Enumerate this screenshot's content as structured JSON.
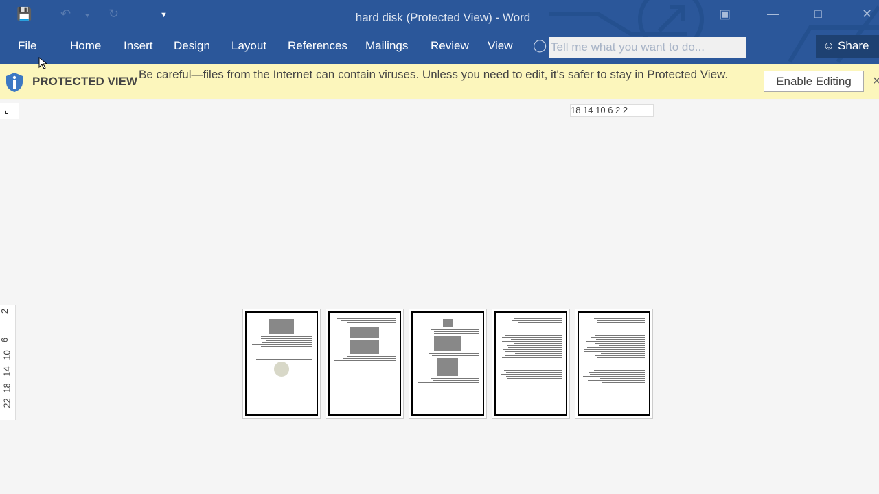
{
  "window": {
    "title": "hard disk (Protected View) - Word"
  },
  "qat": {
    "save": "save-icon",
    "undo": "undo-icon",
    "redo": "redo-icon",
    "customize": "customize-icon"
  },
  "tabs": [
    "File",
    "Home",
    "Insert",
    "Design",
    "Layout",
    "References",
    "Mailings",
    "Review",
    "View"
  ],
  "tell_me": {
    "placeholder": "Tell me what you want to do..."
  },
  "share": {
    "label": "Share"
  },
  "protected_view": {
    "label": "PROTECTED VIEW",
    "message": "Be careful—files from the Internet can contain viruses. Unless you need to edit, it's safer to stay in Protected View.",
    "button": "Enable Editing"
  },
  "ruler": {
    "horizontal": "18  14  10   6    2    2",
    "vertical": [
      "2",
      "2",
      "6",
      "10",
      "14",
      "18",
      "22"
    ]
  },
  "pages": [
    1,
    2,
    3,
    4,
    5
  ]
}
